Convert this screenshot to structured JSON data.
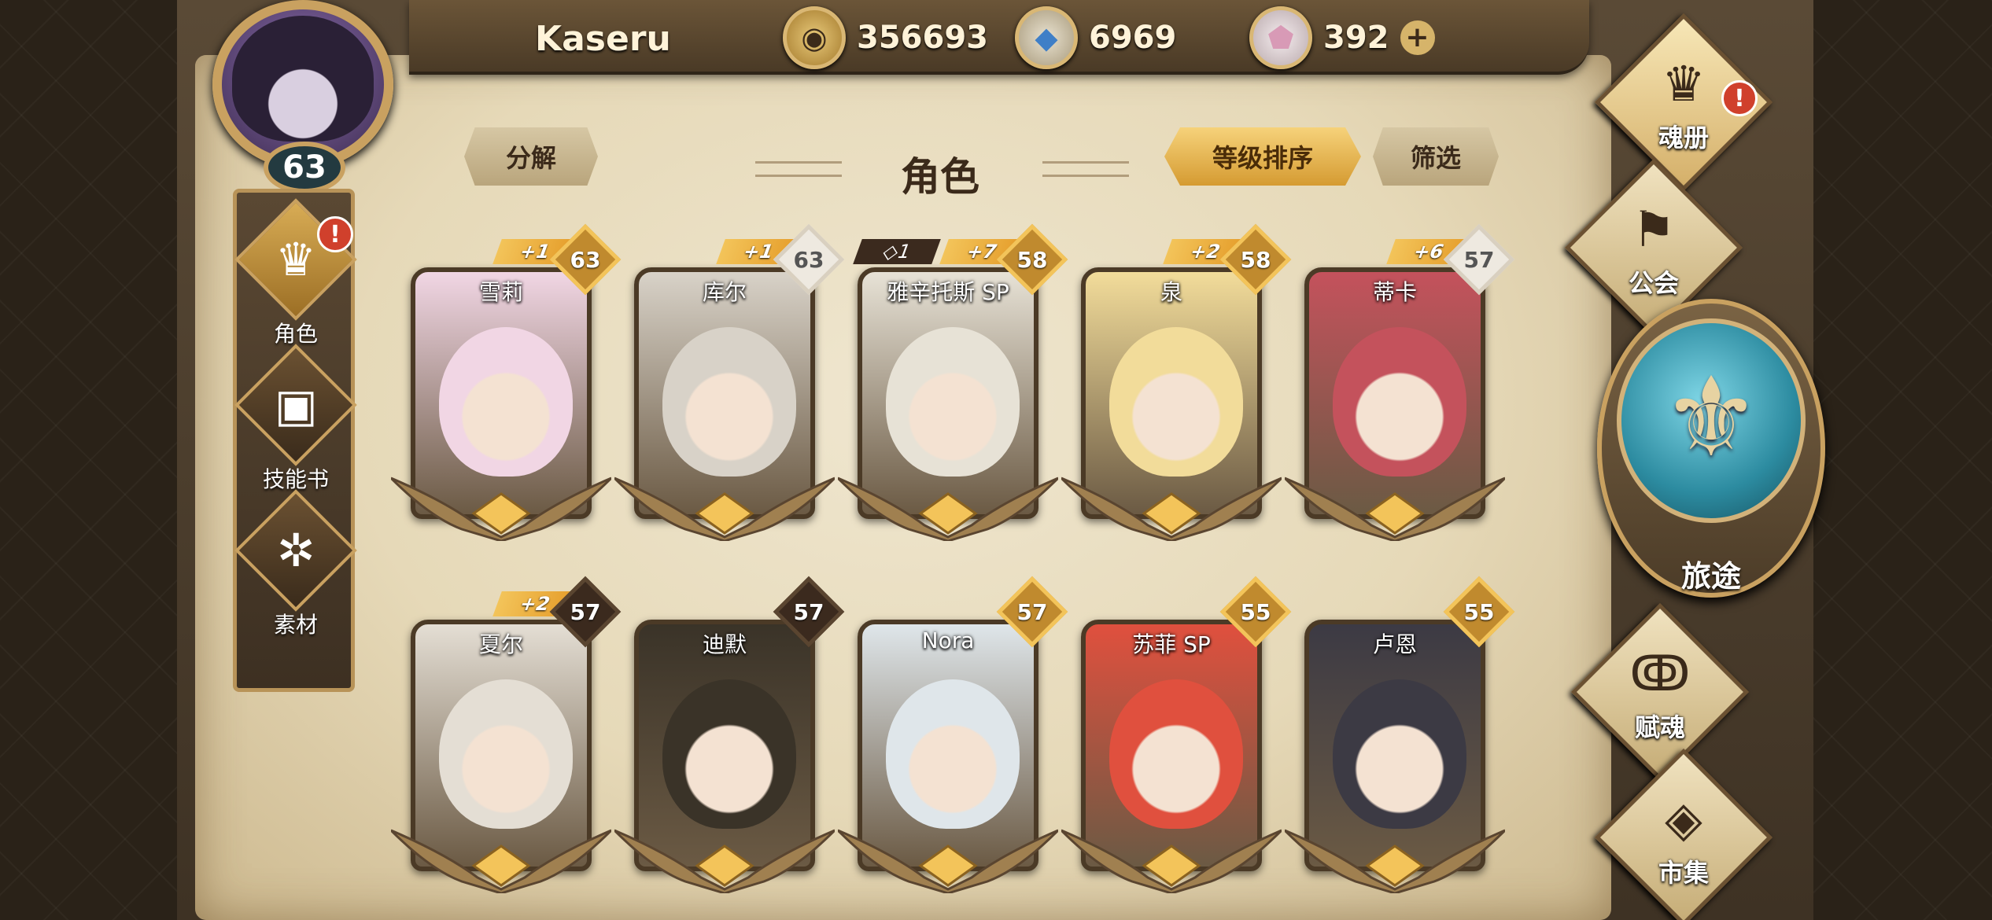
{
  "player": {
    "name": "Kaseru",
    "level": "63"
  },
  "currencies": [
    {
      "icon": "gold-coin-icon",
      "value": "356693"
    },
    {
      "icon": "blue-crystal-icon",
      "value": "6969"
    },
    {
      "icon": "pink-gem-icon",
      "value": "392"
    }
  ],
  "plus_symbol": "+",
  "left_nav": [
    {
      "label": "角色",
      "icon": "helmet-icon",
      "badge": "!"
    },
    {
      "label": "技能书",
      "icon": "skill-book-icon"
    },
    {
      "label": "素材",
      "icon": "material-icon"
    }
  ],
  "toolbar": {
    "decompose": "分解",
    "sort": "等级排序",
    "filter": "筛选"
  },
  "page_title": "角色",
  "characters": [
    {
      "name": "雪莉",
      "level": "63",
      "plus": "+1",
      "level_style": "gold",
      "color": "#f1d6e4"
    },
    {
      "name": "库尔",
      "level": "63",
      "plus": "+1",
      "level_style": "white",
      "color": "#d8d2c8"
    },
    {
      "name": "雅辛托斯 SP",
      "level": "58",
      "plus": "+7",
      "diamond": "◇1",
      "level_style": "gold",
      "color": "#e7e2d6"
    },
    {
      "name": "泉",
      "level": "58",
      "plus": "+2",
      "level_style": "gold",
      "color": "#f2dc9a"
    },
    {
      "name": "蒂卡",
      "level": "57",
      "plus": "+6",
      "level_style": "white",
      "color": "#c4525c"
    },
    {
      "name": "夏尔",
      "level": "57",
      "plus": "+2",
      "level_style": "dark",
      "color": "#e4ded4"
    },
    {
      "name": "迪默",
      "level": "57",
      "level_style": "dark",
      "color": "#3a3328"
    },
    {
      "name": "Nora",
      "level": "57",
      "level_style": "gold",
      "color": "#dfe6ea"
    },
    {
      "name": "苏菲 SP",
      "level": "55",
      "level_style": "gold",
      "color": "#e0503e"
    },
    {
      "name": "卢恩",
      "level": "55",
      "level_style": "gold",
      "color": "#3c3a44"
    }
  ],
  "right_nav": [
    {
      "label": "魂册",
      "icon": "helmet-icon",
      "badge": "!"
    },
    {
      "label": "公会",
      "icon": "guild-flag-icon"
    },
    {
      "label": "旅途",
      "icon": "journey-emblem-icon"
    },
    {
      "label": "赋魂",
      "icon": "soul-swirl-icon"
    },
    {
      "label": "市集",
      "icon": "market-gem-icon"
    }
  ]
}
